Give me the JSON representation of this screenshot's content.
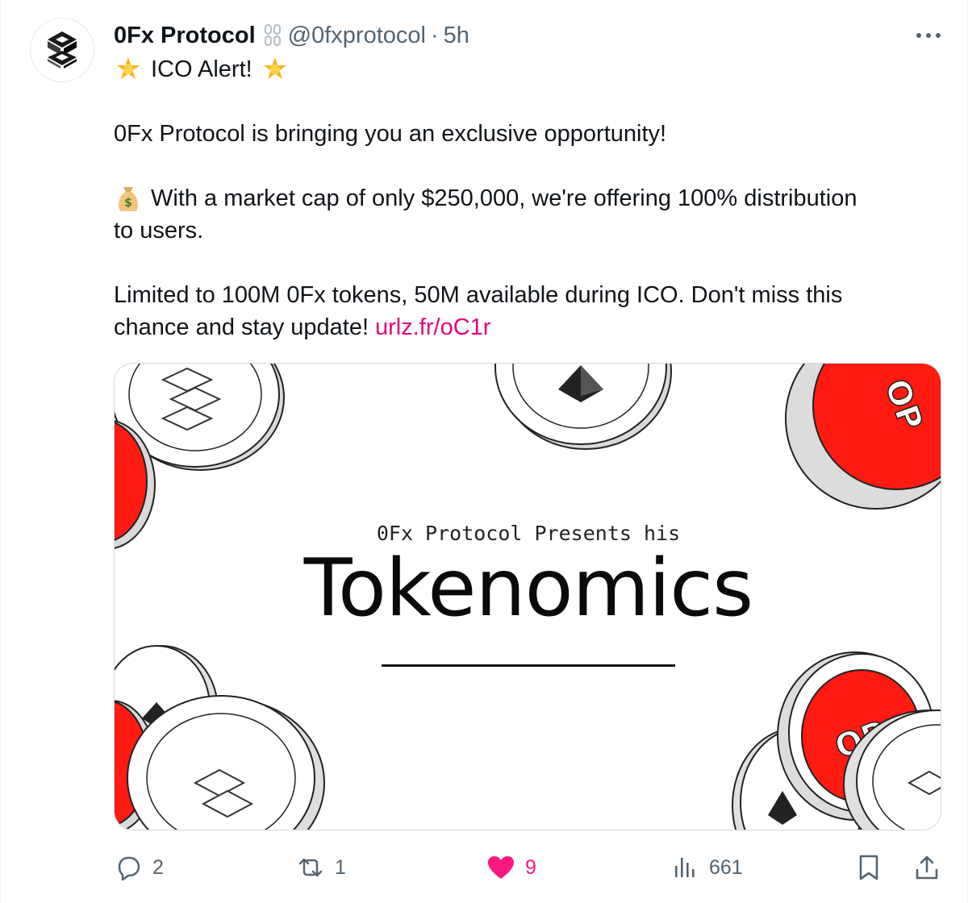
{
  "author": {
    "display_name": "0Fx Protocol",
    "handle": "@0fxprotocol",
    "separator": "·",
    "time": "5h"
  },
  "tweet": {
    "line1": "ICO Alert!",
    "line2": "0Fx Protocol is bringing you an exclusive opportunity!",
    "line3a": "With a market cap of only $250,000, we're offering 100% distribution",
    "line3b": "to users.",
    "line4a": "Limited to 100M 0Fx tokens, 50M available during ICO. Don't miss this",
    "line4b": "chance and stay update!",
    "link": "urlz.fr/oC1r"
  },
  "media": {
    "presents": "0Fx Protocol Presents his",
    "title": "Tokenomics",
    "coin_label": "OP"
  },
  "actions": {
    "replies": "2",
    "reposts": "1",
    "likes": "9",
    "views": "661"
  },
  "colors": {
    "link": "#e6007a",
    "like": "#f91880",
    "muted": "#536471",
    "coin_red": "#ff1a12"
  },
  "icons": [
    "star-emoji-icon",
    "money-bag-emoji-icon",
    "chain-link-icon",
    "more-icon",
    "reply-icon",
    "repost-icon",
    "heart-icon",
    "views-icon",
    "bookmark-icon",
    "share-icon"
  ]
}
